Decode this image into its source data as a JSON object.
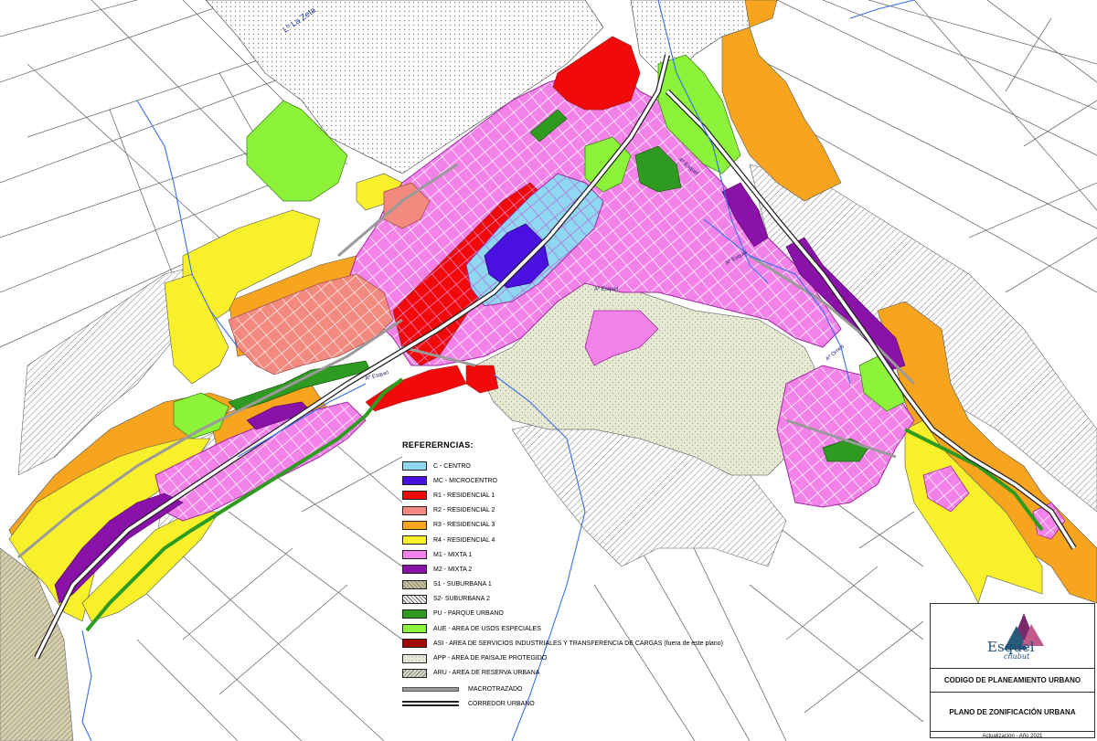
{
  "legend": {
    "title": "REFERERNCIAS:",
    "zones": [
      {
        "code": "C",
        "label": "C - CENTRO",
        "color": "#8fd8f2"
      },
      {
        "code": "MC",
        "label": "MC - MICROCENTRO",
        "color": "#4a10e0"
      },
      {
        "code": "R1",
        "label": "R1 - RESIDENCIAL 1",
        "color": "#f00a0a"
      },
      {
        "code": "R2",
        "label": "R2 - RESIDENCIAL 2",
        "color": "#f28a7f"
      },
      {
        "code": "R3",
        "label": "R3 - RESIDENCIAL 3",
        "color": "#f7a51f"
      },
      {
        "code": "R4",
        "label": "R4 - RESIDENCIAL 4",
        "color": "#f7f02a"
      },
      {
        "code": "M1",
        "label": "M1 - MIXTA 1",
        "color": "#f282e8"
      },
      {
        "code": "M2",
        "label": "M2 - MIXTA 2",
        "color": "#8b12a8"
      },
      {
        "code": "S1",
        "label": "S1 - SUBURBANA 1",
        "color": "#c9c3a3"
      },
      {
        "code": "S2",
        "label": "S2- SUBURBANA 2",
        "color": "#ffffff"
      },
      {
        "code": "PU",
        "label": "PU - PARQUE URBANO",
        "color": "#2e9a20"
      },
      {
        "code": "AUE",
        "label": "AUE - AREA DE USOS ESPECIALES",
        "color": "#8cf23a"
      },
      {
        "code": "ASI",
        "label": "ASI - AREA DE SERVICIOS INDUSTRIALES Y TRANSFERENCIA DE CARGAS (fuera de este plano)",
        "color": "#a30a0a"
      },
      {
        "code": "APP",
        "label": "APP - AREA DE PAISAJE PROTEGIDO",
        "color": "#e8ecd8"
      },
      {
        "code": "ARU",
        "label": "ARU - AREA DE RESERVA URBANA",
        "color": "#dcdcc8"
      }
    ],
    "lines": [
      {
        "label": "MACROTRAZADO"
      },
      {
        "label": "CORREDOR URBANO"
      }
    ]
  },
  "title_block": {
    "logo_name": "Esquel",
    "logo_sub": "chubut",
    "code": "CODIGO DE PLANEAMIENTO URBANO",
    "plan": "PLANO DE ZONIFICACIÓN URBANA",
    "update": "Actualización - Año 2021"
  },
  "map_labels": {
    "lake": "Lº La Zeta",
    "creek_1": "Aº Esquel",
    "creek_2": "Aº Esquel",
    "creek_3": "Aº Esquel",
    "creek_4": "Aº Esquel",
    "creek_5": "Aº Ornes"
  }
}
